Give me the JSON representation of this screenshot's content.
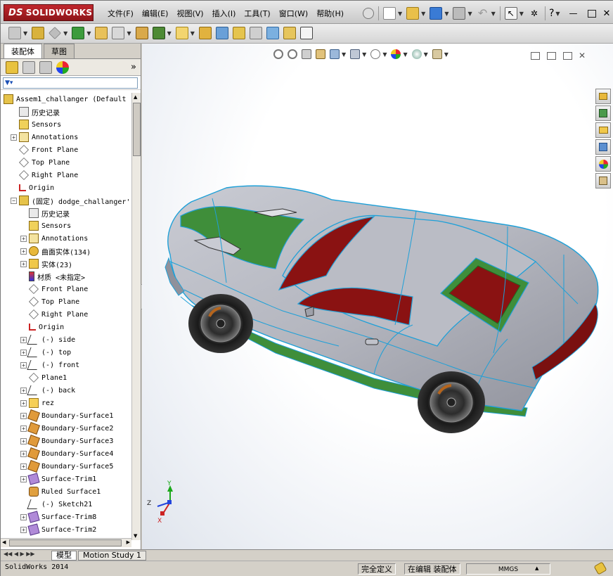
{
  "app": {
    "logo": "SOLIDWORKS",
    "logo_ds": "DS"
  },
  "menu": [
    "文件(F)",
    "编辑(E)",
    "视图(V)",
    "插入(I)",
    "工具(T)",
    "窗口(W)",
    "帮助(H)"
  ],
  "help_btn": "?",
  "tabs": {
    "assembly": "装配体",
    "sketch": "草图"
  },
  "tree": {
    "root": "Assem1_challanger  (Default",
    "items": [
      {
        "label": "历史记录",
        "icon": "history-icon",
        "indent": 1,
        "exp": false
      },
      {
        "label": "Sensors",
        "icon": "sensor-icon",
        "indent": 1,
        "exp": false
      },
      {
        "label": "Annotations",
        "icon": "annotation-icon",
        "indent": 1,
        "exp": true
      },
      {
        "label": "Front Plane",
        "icon": "plane-icon",
        "indent": 1,
        "exp": false
      },
      {
        "label": "Top Plane",
        "icon": "plane-icon",
        "indent": 1,
        "exp": false
      },
      {
        "label": "Right Plane",
        "icon": "plane-icon",
        "indent": 1,
        "exp": false
      },
      {
        "label": "Origin",
        "icon": "origin-icon",
        "indent": 1,
        "exp": false
      },
      {
        "label": "(固定) dodge_challanger'",
        "icon": "part-icon",
        "indent": 1,
        "exp": true,
        "open": true
      },
      {
        "label": "历史记录",
        "icon": "history-icon",
        "indent": 2,
        "exp": false
      },
      {
        "label": "Sensors",
        "icon": "sensor-icon",
        "indent": 2,
        "exp": false
      },
      {
        "label": "Annotations",
        "icon": "annotation-icon",
        "indent": 2,
        "exp": true
      },
      {
        "label": "曲面实体(134)",
        "icon": "surface-folder-icon",
        "indent": 2,
        "exp": true
      },
      {
        "label": "实体(23)",
        "icon": "solid-folder-icon",
        "indent": 2,
        "exp": true
      },
      {
        "label": "材质 <未指定>",
        "icon": "material-icon",
        "indent": 2,
        "exp": false
      },
      {
        "label": "Front Plane",
        "icon": "plane-icon",
        "indent": 2,
        "exp": false
      },
      {
        "label": "Top Plane",
        "icon": "plane-icon",
        "indent": 2,
        "exp": false
      },
      {
        "label": "Right Plane",
        "icon": "plane-icon",
        "indent": 2,
        "exp": false
      },
      {
        "label": "Origin",
        "icon": "origin-icon",
        "indent": 2,
        "exp": false
      },
      {
        "label": "(-) side",
        "icon": "sketch-icon",
        "indent": 2,
        "exp": true
      },
      {
        "label": "(-) top",
        "icon": "sketch-icon",
        "indent": 2,
        "exp": true
      },
      {
        "label": "(-) front",
        "icon": "sketch-icon",
        "indent": 2,
        "exp": true
      },
      {
        "label": "Plane1",
        "icon": "plane-icon",
        "indent": 2,
        "exp": false
      },
      {
        "label": "(-) back",
        "icon": "sketch-icon",
        "indent": 2,
        "exp": true
      },
      {
        "label": "rez",
        "icon": "folder-icon",
        "indent": 2,
        "exp": true
      },
      {
        "label": "Boundary-Surface1",
        "icon": "boundary-surface-icon",
        "indent": 2,
        "exp": true
      },
      {
        "label": "Boundary-Surface2",
        "icon": "boundary-surface-icon",
        "indent": 2,
        "exp": true
      },
      {
        "label": "Boundary-Surface3",
        "icon": "boundary-surface-icon",
        "indent": 2,
        "exp": true
      },
      {
        "label": "Boundary-Surface4",
        "icon": "boundary-surface-icon",
        "indent": 2,
        "exp": true
      },
      {
        "label": "Boundary-Surface5",
        "icon": "boundary-surface-icon",
        "indent": 2,
        "exp": true
      },
      {
        "label": "Surface-Trim1",
        "icon": "trim-icon",
        "indent": 2,
        "exp": true
      },
      {
        "label": "Ruled Surface1",
        "icon": "ruled-surface-icon",
        "indent": 2,
        "exp": false
      },
      {
        "label": "(-) Sketch21",
        "icon": "sketch-icon",
        "indent": 2,
        "exp": false
      },
      {
        "label": "Surface-Trim8",
        "icon": "trim-icon",
        "indent": 2,
        "exp": true
      },
      {
        "label": "Surface-Trim2",
        "icon": "trim-icon",
        "indent": 2,
        "exp": true
      }
    ]
  },
  "bottom_tabs": [
    "模型",
    "Motion Study 1"
  ],
  "status": {
    "app": "SolidWorks 2014",
    "defined": "完全定义",
    "editing": "在编辑 装配体",
    "units": "MMGS"
  },
  "triad": {
    "x": "X",
    "y": "Y",
    "z": "Z"
  },
  "colors": {
    "car_body": "#b3b5bd",
    "glass": "#8a1212",
    "wireframe_edge": "#1ea0d8",
    "green_surface": "#3f8e3a",
    "accent_logo": "#b01e24"
  }
}
